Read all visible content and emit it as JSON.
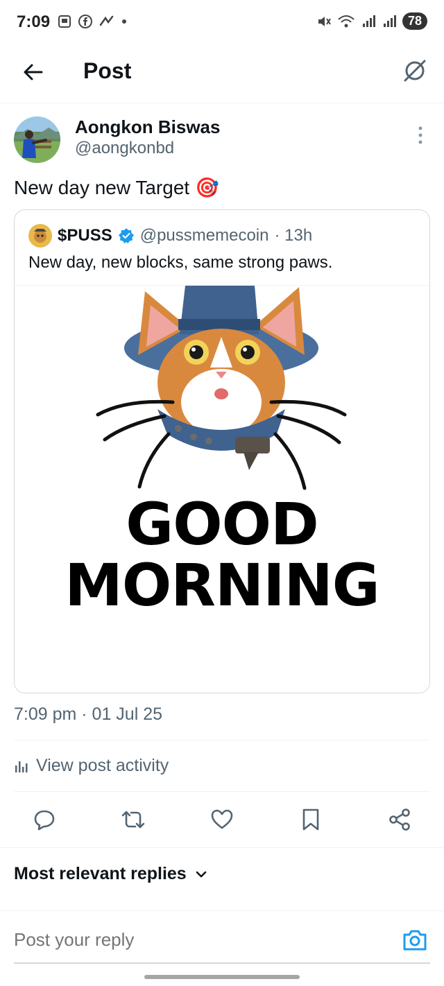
{
  "status_bar": {
    "time": "7:09",
    "battery": "78"
  },
  "header": {
    "title": "Post"
  },
  "author": {
    "name": "Aongkon Biswas",
    "handle": "@aongkonbd"
  },
  "post": {
    "text": "New day new Target",
    "emoji": "🎯",
    "timestamp": "7:09 pm · 01 Jul 25"
  },
  "quoted_post": {
    "name": "$PUSS",
    "handle": "@pussmemecoin",
    "age": "· 13h",
    "text": "New day, new blocks, same strong paws.",
    "image_text_line1": "GOOD",
    "image_text_line2": "MORNING"
  },
  "activity": {
    "label": "View post activity"
  },
  "replies": {
    "sort_label": "Most relevant replies",
    "placeholder": "Post your reply"
  },
  "colors": {
    "accent": "#1d9bf0",
    "secondary_text": "#536471",
    "border": "#cfd9de"
  },
  "icons": [
    "back-arrow-icon",
    "grok-icon",
    "more-vertical-icon",
    "verified-badge-icon",
    "analytics-icon",
    "reply-icon",
    "repost-icon",
    "like-icon",
    "bookmark-icon",
    "share-icon",
    "chevron-down-icon",
    "camera-icon"
  ]
}
